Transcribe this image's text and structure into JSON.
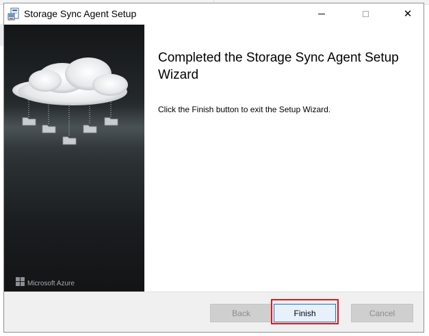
{
  "window": {
    "title": "Storage Sync Agent Setup",
    "app_icon": "installer-icon",
    "controls": {
      "minimize": "minimize-icon",
      "maximize": "maximize-icon",
      "close": "close-icon"
    }
  },
  "banner": {
    "illustration": "cloud-with-folders",
    "brand_text": "Microsoft Azure",
    "brand_icon": "windows-logo-icon"
  },
  "content": {
    "heading": "Completed the Storage Sync Agent Setup Wizard",
    "body": "Click the Finish button to exit the Setup Wizard."
  },
  "footer": {
    "back_label": "Back",
    "back_enabled": false,
    "finish_label": "Finish",
    "cancel_label": "Cancel",
    "cancel_enabled": false
  },
  "colors": {
    "highlight": "#e0141e",
    "primary_button_border": "#1a73c7",
    "banner_dark": "#141617"
  }
}
